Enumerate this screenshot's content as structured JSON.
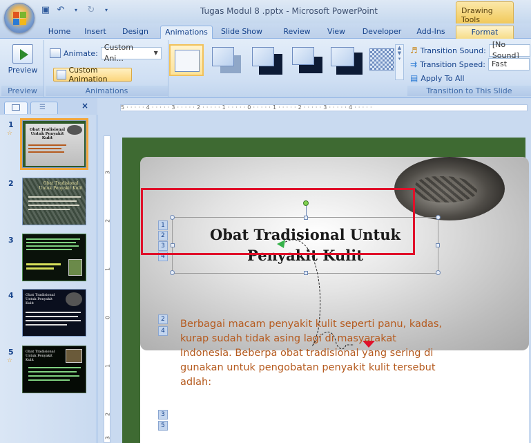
{
  "window": {
    "title": "Tugas Modul 8 .pptx - Microsoft PowerPoint",
    "context_tab_group": "Drawing Tools"
  },
  "tabs": [
    "Home",
    "Insert",
    "Design",
    "Animations",
    "Slide Show",
    "Review",
    "View",
    "Developer",
    "Add-Ins",
    "Format"
  ],
  "active_tab": "Animations",
  "ribbon": {
    "preview_group": {
      "button_label": "Preview",
      "group_label": "Preview"
    },
    "animations_group": {
      "animate_label": "Animate:",
      "animate_value": "Custom Ani...",
      "custom_animation_label": "Custom Animation",
      "group_label": "Animations"
    },
    "transition_group": {
      "sound_label": "Transition Sound:",
      "sound_value": "[No Sound]",
      "speed_label": "Transition Speed:",
      "speed_value": "Fast",
      "apply_all_label": "Apply To All",
      "group_label": "Transition to This Slide"
    }
  },
  "ruler": {
    "top_scale": "5 · · · · · 4 · · · · · 3 · · · · · 2 · · · · · 1 · · · · · 0 · · · · · 1 · · · · · 2 · · · · · 3 · · · · · 4 · · · · ·",
    "left_numbers": [
      "3",
      "2",
      "1",
      "0",
      "1",
      "2",
      "3"
    ]
  },
  "slides_panel": {
    "slides": [
      {
        "number": "1",
        "has_animation": true,
        "title": "Obat Tradisional Untuk Penyakit Kulit"
      },
      {
        "number": "2",
        "has_animation": false,
        "title": "Obat Tradisional Untuk Penyakit Kulit"
      },
      {
        "number": "3",
        "has_animation": false,
        "title": ""
      },
      {
        "number": "4",
        "has_animation": false,
        "title": "Obat Tradisional Untuk Penyakit Kulit"
      },
      {
        "number": "5",
        "has_animation": true,
        "title": "Obat Tradisional Untuk Penyakit Kulit"
      }
    ]
  },
  "slide": {
    "title_line1": "Obat Tradisional Untuk",
    "title_line2": "Penyakit Kulit",
    "title_tags": [
      "1",
      "2",
      "3",
      "4"
    ],
    "body_tags": [
      "2",
      "4"
    ],
    "body_text": "Berbagai macam penyakit kulit seperti panu, kadas, kurap sudah tidak asing lagi di masyarakat Indonesia. Beberpa obat tradisional yang sering di gunakan untuk pengobatan penyakit kulit tersebut adlah:",
    "bottom_tags": [
      "3",
      "5"
    ]
  },
  "colors": {
    "slide_background": "#3e6a32",
    "body_text": "#b55a1e",
    "highlight_box": "#e0102a"
  }
}
